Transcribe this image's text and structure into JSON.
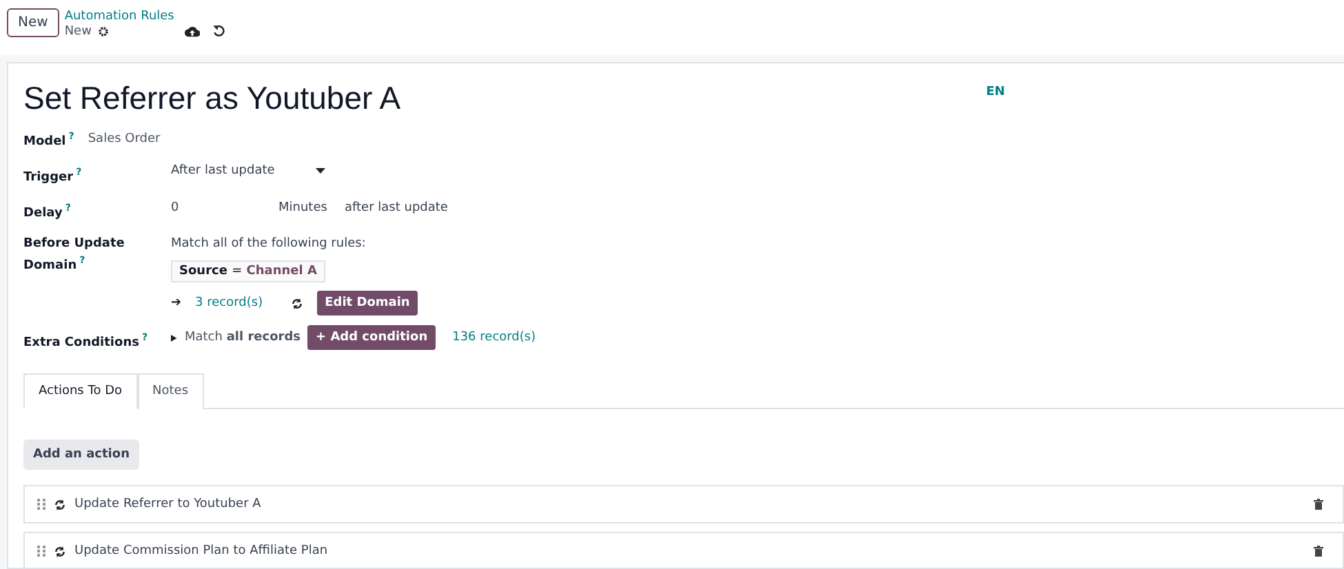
{
  "control_panel": {
    "new_button": "New",
    "breadcrumb": "Automation Rules",
    "record_name": "New"
  },
  "form": {
    "title": "Set Referrer as Youtuber A",
    "language": "EN",
    "model": {
      "label": "Model",
      "help": "?",
      "value": "Sales Order"
    },
    "trigger": {
      "label": "Trigger",
      "help": "?",
      "value": "After last update"
    },
    "delay": {
      "label": "Delay",
      "help": "?",
      "value": "0",
      "unit": "Minutes",
      "suffix": "after last update"
    },
    "before_update_domain": {
      "label": "Before Update Domain",
      "help": "?",
      "intro": "Match all of the following rules:",
      "rule_field": "Source",
      "rule_operator": "=",
      "rule_value": "Channel A",
      "arrow": "➔",
      "records": "3 record(s)",
      "edit_button": "Edit Domain"
    },
    "extra_conditions": {
      "label": "Extra Conditions",
      "help": "?",
      "expanded": false,
      "match": "Match **all records**",
      "add_button": "+ Add condition",
      "records": "136 record(s)"
    },
    "tabs": [
      {
        "label": "Actions To Do",
        "selected": true
      },
      {
        "label": "Notes",
        "selected": false
      }
    ],
    "add_action_button": "Add an action",
    "actions": [
      {
        "name": "Update Referrer to Youtuber A"
      },
      {
        "name": "Update Commission Plan to Affiliate Plan"
      }
    ]
  }
}
